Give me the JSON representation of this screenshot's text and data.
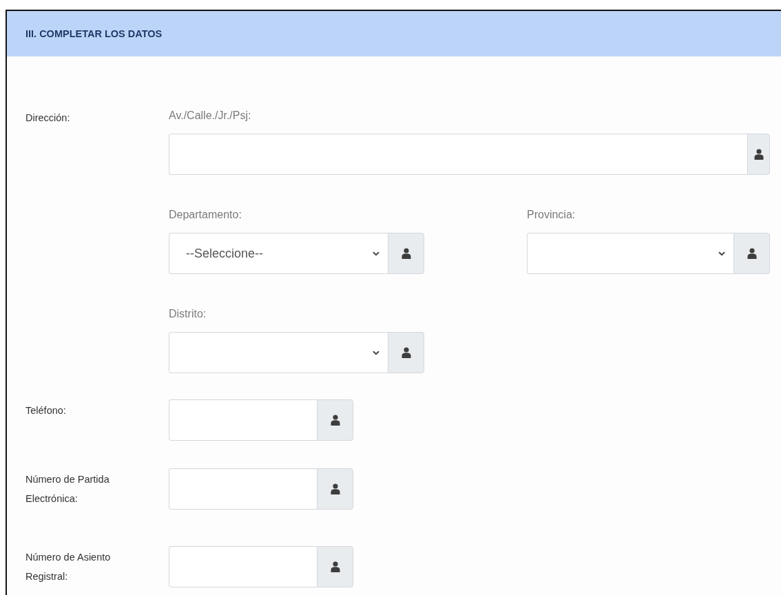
{
  "section": {
    "title": "III. COMPLETAR LOS DATOS"
  },
  "address": {
    "label": "Dirección:",
    "street": {
      "label": "Av./Calle./Jr./Psj:"
    },
    "selects": [
      {
        "label": "Departamento:",
        "value": "--Seleccione--"
      },
      {
        "label": "Provincia:"
      },
      {
        "label": "Distrito:"
      }
    ]
  },
  "text_fields": [
    {
      "label": "Teléfono:"
    },
    {
      "label": "Número de Partida Electrónica:"
    },
    {
      "label": "Número de Asiento Registral:"
    }
  ]
}
